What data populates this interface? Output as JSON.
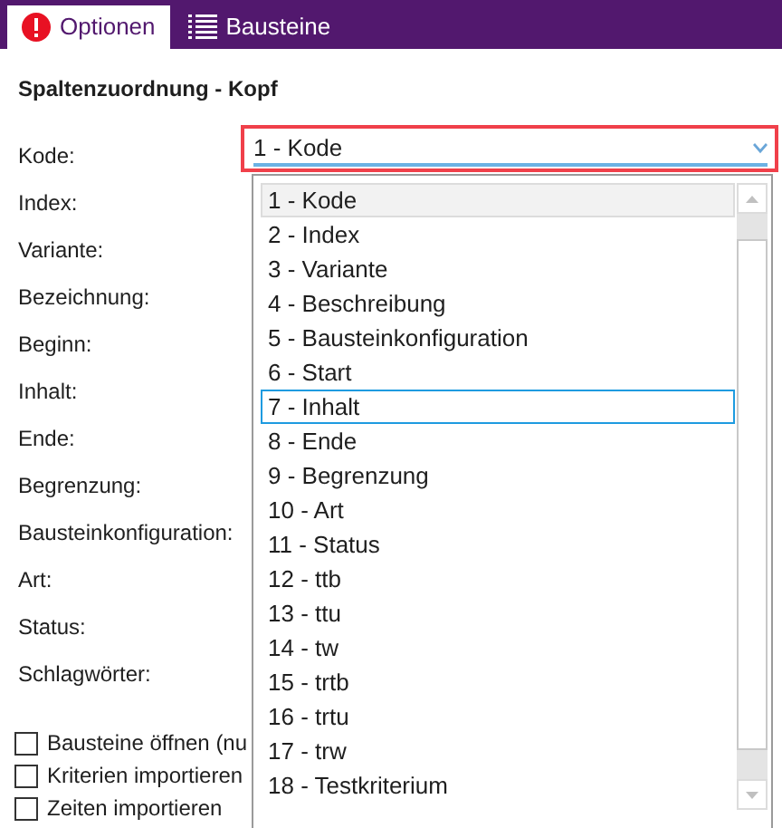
{
  "tabs": [
    {
      "label": "Optionen",
      "selected": true,
      "kind": "alert"
    },
    {
      "label": "Bausteine",
      "selected": false,
      "kind": "list"
    }
  ],
  "section_title": "Spaltenzuordnung - Kopf",
  "fields": [
    {
      "label": "Kode:"
    },
    {
      "label": "Index:"
    },
    {
      "label": "Variante:"
    },
    {
      "label": "Bezeichnung:"
    },
    {
      "label": "Beginn:"
    },
    {
      "label": "Inhalt:"
    },
    {
      "label": "Ende:"
    },
    {
      "label": "Begrenzung:"
    },
    {
      "label": "Bausteinkonfiguration:"
    },
    {
      "label": "Art:"
    },
    {
      "label": "Status:"
    },
    {
      "label": "Schlagwörter:"
    }
  ],
  "dropdown": {
    "value": "1 - Kode",
    "options": [
      {
        "label": "1 - Kode",
        "selected": true,
        "focused": false
      },
      {
        "label": "2 - Index",
        "selected": false,
        "focused": false
      },
      {
        "label": "3 - Variante",
        "selected": false,
        "focused": false
      },
      {
        "label": "4 - Beschreibung",
        "selected": false,
        "focused": false
      },
      {
        "label": "5 - Bausteinkonfiguration",
        "selected": false,
        "focused": false
      },
      {
        "label": "6 - Start",
        "selected": false,
        "focused": false
      },
      {
        "label": "7 - Inhalt",
        "selected": false,
        "focused": true
      },
      {
        "label": "8 - Ende",
        "selected": false,
        "focused": false
      },
      {
        "label": "9 - Begrenzung",
        "selected": false,
        "focused": false
      },
      {
        "label": "10 - Art",
        "selected": false,
        "focused": false
      },
      {
        "label": "11 - Status",
        "selected": false,
        "focused": false
      },
      {
        "label": "12 - ttb",
        "selected": false,
        "focused": false
      },
      {
        "label": "13 - ttu",
        "selected": false,
        "focused": false
      },
      {
        "label": "14 - tw",
        "selected": false,
        "focused": false
      },
      {
        "label": "15 - trtb",
        "selected": false,
        "focused": false
      },
      {
        "label": "16 - trtu",
        "selected": false,
        "focused": false
      },
      {
        "label": "17 - trw",
        "selected": false,
        "focused": false
      },
      {
        "label": "18 - Testkriterium",
        "selected": false,
        "focused": false
      }
    ]
  },
  "checkboxes": [
    {
      "label": "Bausteine öffnen (nu",
      "checked": false
    },
    {
      "label": "Kriterien importieren",
      "checked": false
    },
    {
      "label": "Zeiten importieren",
      "checked": false
    }
  ]
}
